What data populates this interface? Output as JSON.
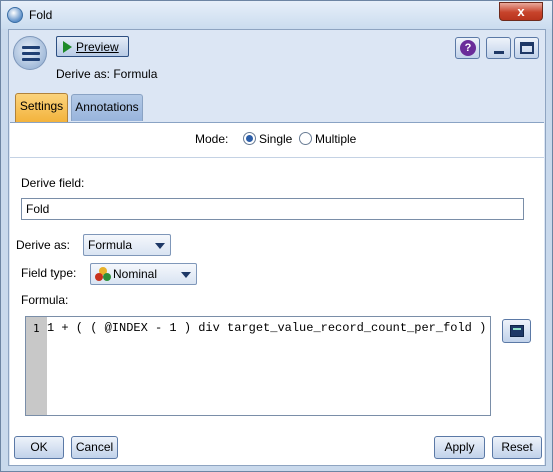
{
  "window": {
    "title": "Fold",
    "close_label": "x"
  },
  "header": {
    "preview_label": "Preview",
    "caption": "Derive as: Formula",
    "help_label": "?"
  },
  "tabs": [
    {
      "label": "Settings",
      "active": true
    },
    {
      "label": "Annotations",
      "active": false
    }
  ],
  "mode": {
    "label": "Mode:",
    "options": [
      {
        "label": "Single",
        "selected": true
      },
      {
        "label": "Multiple",
        "selected": false
      }
    ]
  },
  "derive_field": {
    "label": "Derive field:",
    "value": "Fold"
  },
  "derive_as": {
    "label": "Derive as:",
    "value": "Formula"
  },
  "field_type": {
    "label": "Field type:",
    "value": "Nominal"
  },
  "formula": {
    "label": "Formula:",
    "line_number": "1",
    "code": "1 + ( ( @INDEX - 1 ) div target_value_record_count_per_fold )"
  },
  "buttons": {
    "ok": "OK",
    "cancel": "Cancel",
    "apply": "Apply",
    "reset": "Reset"
  },
  "colors": {
    "active_tab": "#f3b33c",
    "accent": "#2c5ea8"
  }
}
